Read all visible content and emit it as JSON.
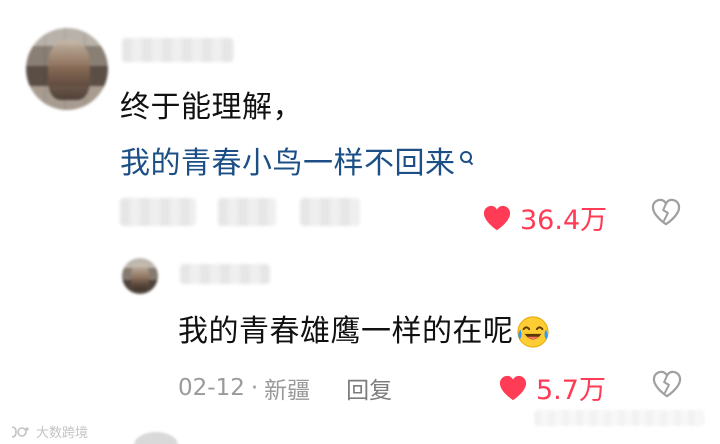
{
  "comment": {
    "line1": "终于能理解，",
    "line2": "我的青春小鸟一样不回来",
    "likes": "36.4万"
  },
  "reply": {
    "text": "我的青春雄鹰一样的在呢",
    "date": "02-12",
    "separator": "·",
    "location": "新疆",
    "reply_label": "回复",
    "likes": "5.7万"
  },
  "watermark": {
    "text": "大数跨境"
  },
  "colors": {
    "like_red": "#ff3b55",
    "link_blue": "#1c4f86"
  },
  "icons": {
    "heart": "heart-icon",
    "broken_heart": "broken-heart-icon",
    "search": "search-icon",
    "laugh": "laugh-cry-emoji-icon",
    "watermark_logo": "watermark-logo-icon"
  }
}
